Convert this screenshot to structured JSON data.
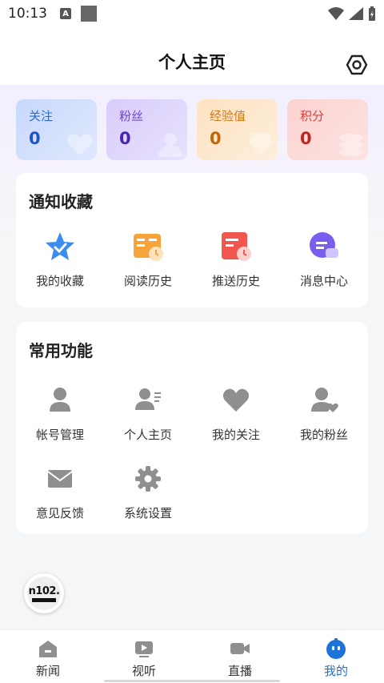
{
  "status_bar": {
    "time": "10:13",
    "notif_letter": "A"
  },
  "header": {
    "title": "个人主页"
  },
  "stats": [
    {
      "label": "关注",
      "value": "0"
    },
    {
      "label": "粉丝",
      "value": "0"
    },
    {
      "label": "经验值",
      "value": "0"
    },
    {
      "label": "积分",
      "value": "0"
    }
  ],
  "notify_section": {
    "title": "通知收藏",
    "items": [
      {
        "label": "我的收藏",
        "icon": "star-icon"
      },
      {
        "label": "阅读历史",
        "icon": "book-icon"
      },
      {
        "label": "推送历史",
        "icon": "calendar-icon"
      },
      {
        "label": "消息中心",
        "icon": "chat-icon"
      }
    ]
  },
  "common_section": {
    "title": "常用功能",
    "items": [
      {
        "label": "帐号管理",
        "icon": "user-icon"
      },
      {
        "label": "个人主页",
        "icon": "profile-card-icon"
      },
      {
        "label": "我的关注",
        "icon": "heart-icon"
      },
      {
        "label": "我的粉丝",
        "icon": "user-heart-icon"
      },
      {
        "label": "意见反馈",
        "icon": "mail-icon"
      },
      {
        "label": "系统设置",
        "icon": "gear-icon"
      }
    ]
  },
  "radio_logo": {
    "text": "n102."
  },
  "bottom_nav": [
    {
      "label": "新闻",
      "icon": "home-icon",
      "active": false
    },
    {
      "label": "视听",
      "icon": "play-icon",
      "active": false
    },
    {
      "label": "直播",
      "icon": "video-camera-icon",
      "active": false
    },
    {
      "label": "我的",
      "icon": "smiley-icon",
      "active": true
    }
  ],
  "colors": {
    "accent": "#1c73d8",
    "icon_gray": "#8f8f8f"
  }
}
